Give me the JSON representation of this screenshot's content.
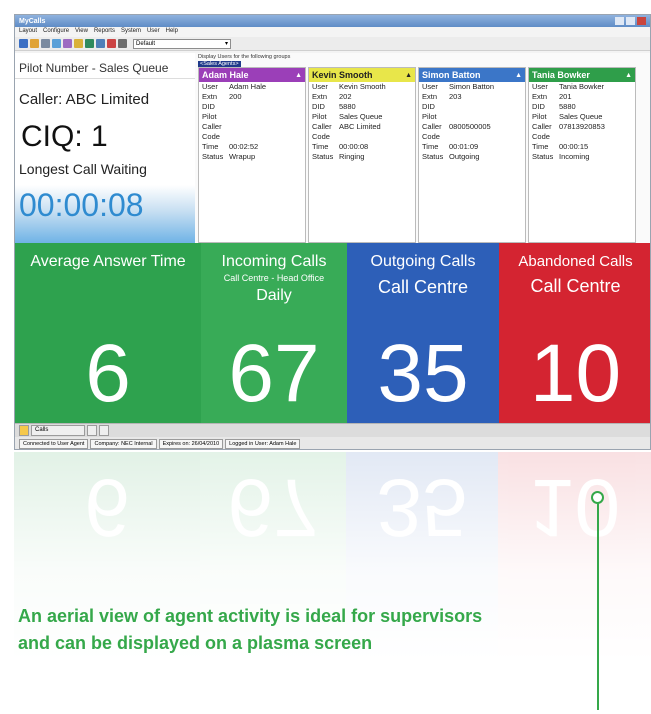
{
  "window": {
    "title": "MyCalls",
    "menu": [
      "Layout",
      "Configure",
      "View",
      "Reports",
      "System",
      "User",
      "Help"
    ],
    "layout_select": "Default"
  },
  "pilot": {
    "title": "Pilot Number - Sales Queue",
    "caller": "Caller: ABC Limited",
    "ciq": "CIQ: 1",
    "longest_label": "Longest Call Waiting",
    "longest_time": "00:00:08"
  },
  "agents_panel": {
    "display_users_label": "Display Users for the following groups",
    "group": "<Sales Agents>"
  },
  "agents": [
    {
      "name": "Adam Hale",
      "header_color": "#9b3fb8",
      "rows": [
        [
          "User",
          "Adam Hale"
        ],
        [
          "Extn",
          "200"
        ],
        [
          "DID",
          ""
        ],
        [
          "Pilot",
          ""
        ],
        [
          "Caller",
          ""
        ],
        [
          "Code",
          ""
        ],
        [
          "Time",
          "00:02:52"
        ],
        [
          "Status",
          "Wrapup"
        ]
      ]
    },
    {
      "name": "Kevin Smooth",
      "header_color": "#e8e64a",
      "rows": [
        [
          "User",
          "Kevin Smooth"
        ],
        [
          "Extn",
          "202"
        ],
        [
          "DID",
          "5880"
        ],
        [
          "Pilot",
          "Sales Queue"
        ],
        [
          "Caller",
          "ABC Limited"
        ],
        [
          "Code",
          ""
        ],
        [
          "Time",
          "00:00:08"
        ],
        [
          "Status",
          "Ringing"
        ]
      ]
    },
    {
      "name": "Simon Batton",
      "header_color": "#3b76c8",
      "rows": [
        [
          "User",
          "Simon Batton"
        ],
        [
          "Extn",
          "203"
        ],
        [
          "DID",
          ""
        ],
        [
          "Pilot",
          ""
        ],
        [
          "Caller",
          "0800500005"
        ],
        [
          "Code",
          ""
        ],
        [
          "Time",
          "00:01:09"
        ],
        [
          "Status",
          "Outgoing"
        ]
      ]
    },
    {
      "name": "Tania Bowker",
      "header_color": "#2f9e4a",
      "rows": [
        [
          "User",
          "Tania Bowker"
        ],
        [
          "Extn",
          "201"
        ],
        [
          "DID",
          "5880"
        ],
        [
          "Pilot",
          "Sales Queue"
        ],
        [
          "Caller",
          "07813920853"
        ],
        [
          "Code",
          ""
        ],
        [
          "Time",
          "00:00:15"
        ],
        [
          "Status",
          "Incoming"
        ]
      ]
    }
  ],
  "tiles": [
    {
      "id": "average-answer-time",
      "line1": "Average Answer Time",
      "line2": "",
      "line3": "",
      "value": "6",
      "color": "#2ea24e"
    },
    {
      "id": "incoming-calls",
      "line1": "Incoming Calls",
      "line2": "Call Centre - Head Office",
      "line3": "Daily",
      "value": "67",
      "color": "#38ab57"
    },
    {
      "id": "outgoing-calls",
      "line1": "Outgoing Calls",
      "line2": "Call Centre",
      "line3": "",
      "value": "35",
      "color": "#2d5fb8"
    },
    {
      "id": "abandoned-calls",
      "line1": "Abandoned Calls",
      "line2": "Call Centre",
      "line3": "",
      "value": "10",
      "color": "#d42431"
    }
  ],
  "taskbar": {
    "tab": "Calls"
  },
  "statusbar": [
    "Connected to User Agent",
    "Company: NEC Internal",
    "Expires on: 26/04/2010",
    "Logged in User: Adam Hale"
  ],
  "caption": "An aerial view of agent activity is ideal for supervisors and can be displayed on a plasma screen",
  "colors": {
    "accent_green": "#35a84a"
  }
}
